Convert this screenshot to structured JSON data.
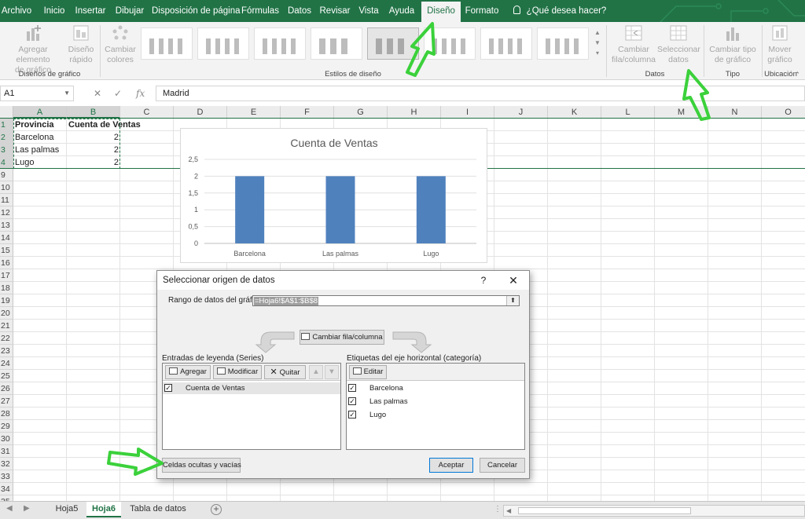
{
  "ribbon": {
    "tabs": [
      "Archivo",
      "Inicio",
      "Insertar",
      "Dibujar",
      "Disposición de página",
      "Fórmulas",
      "Datos",
      "Revisar",
      "Vista",
      "Ayuda",
      "Diseño",
      "Formato"
    ],
    "active_tab": "Diseño",
    "tell_me": "¿Qué desea hacer?",
    "groups": {
      "disenos_grafico": "Diseños de gráfico",
      "estilos_diseno": "Estilos de diseño",
      "datos": "Datos",
      "tipo": "Tipo",
      "ubicacion": "Ubicación"
    },
    "buttons": {
      "agregar_elemento": "Agregar elemento\nde gráfico",
      "diseno_rapido": "Diseño\nrápido",
      "cambiar_colores": "Cambiar\ncolores",
      "cambiar_fila_columna": "Cambiar\nfila/columna",
      "seleccionar_datos": "Seleccionar\ndatos",
      "cambiar_tipo": "Cambiar tipo\nde gráfico",
      "mover_grafico": "Mover\ngráfico"
    }
  },
  "formula_bar": {
    "name_box": "A1",
    "value": "Madrid"
  },
  "grid": {
    "columns": [
      "A",
      "B",
      "C",
      "D",
      "E",
      "F",
      "G",
      "H",
      "I",
      "J",
      "K",
      "L",
      "M",
      "N",
      "O"
    ],
    "rows": [
      "1",
      "2",
      "3",
      "4",
      "9",
      "10",
      "11",
      "12",
      "13",
      "14",
      "15",
      "16",
      "17",
      "18",
      "19",
      "20",
      "21",
      "22",
      "23",
      "24",
      "25",
      "26",
      "27",
      "28",
      "29",
      "30",
      "31",
      "32",
      "33",
      "34",
      "35"
    ],
    "cells": {
      "a1": "Provincia",
      "b1": "Cuenta de Ventas",
      "a2": "Barcelona",
      "b2": "2",
      "a3": "Las palmas",
      "b3": "2",
      "a4": "Lugo",
      "b4": "2"
    }
  },
  "chart_data": {
    "type": "bar",
    "title": "Cuenta de Ventas",
    "categories": [
      "Barcelona",
      "Las palmas",
      "Lugo"
    ],
    "values": [
      2,
      2,
      2
    ],
    "ylim": [
      0,
      2.5
    ],
    "yticks": [
      "0",
      "0,5",
      "1",
      "1,5",
      "2",
      "2,5"
    ],
    "grid": true,
    "legend": "none",
    "bar_color": "#4f81bd"
  },
  "dialog": {
    "title": "Seleccionar origen de datos",
    "help": "?",
    "close": "✕",
    "range_label": "Rango de datos del gráfico:",
    "range_value": "=Hoja6!$A$1:$B$8",
    "switch_button": "Cambiar fila/columna",
    "legend_label": "Entradas de leyenda (Series)",
    "axis_label": "Etiquetas del eje horizontal (categoría)",
    "add_button": "Agregar",
    "edit_button": "Modificar",
    "remove_button": "Quitar",
    "axis_edit_button": "Editar",
    "series": [
      "Cuenta de Ventas"
    ],
    "categories": [
      "Barcelona",
      "Las palmas",
      "Lugo"
    ],
    "hidden_cells_button": "Celdas ocultas y vacías",
    "ok_button": "Aceptar",
    "cancel_button": "Cancelar"
  },
  "sheets": {
    "tabs": [
      "Hoja5",
      "Hoja6",
      "Tabla de datos"
    ],
    "active": "Hoja6",
    "add": "+"
  },
  "colors": {
    "excel_green": "#217346",
    "arrow_green": "#3bd13b",
    "bar": "#4f81bd"
  }
}
